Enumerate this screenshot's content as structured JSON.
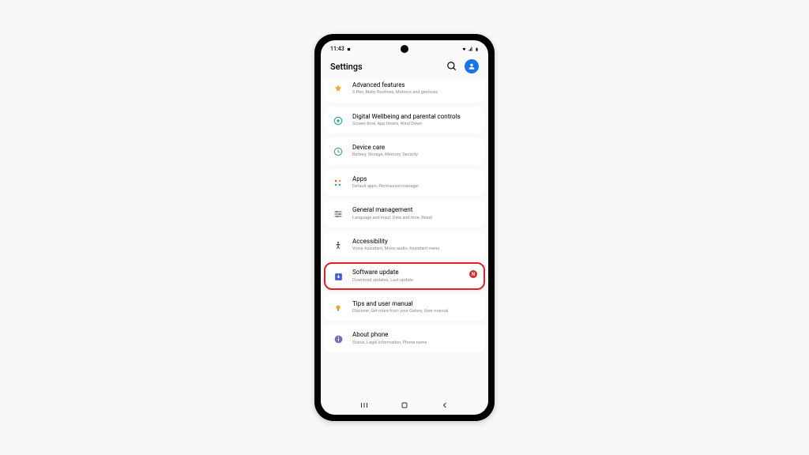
{
  "statusBar": {
    "time": "11:43"
  },
  "header": {
    "title": "Settings"
  },
  "items": [
    {
      "title": "Advanced features",
      "sub": "S Pen, Bixby Routines, Motions and gestures"
    },
    {
      "title": "Digital Wellbeing and parental controls",
      "sub": "Screen time, App timers, Wind Down"
    },
    {
      "title": "Device care",
      "sub": "Battery, Storage, Memory, Security"
    },
    {
      "title": "Apps",
      "sub": "Default apps, Permission manager"
    },
    {
      "title": "General management",
      "sub": "Language and input, Date and time, Reset"
    },
    {
      "title": "Accessibility",
      "sub": "Voice Assistant, Mono audio, Assistant menu"
    },
    {
      "title": "Software update",
      "sub": "Download updates, Last update"
    },
    {
      "title": "Tips and user manual",
      "sub": "Discover, Get more from your Galaxy, User manual"
    },
    {
      "title": "About phone",
      "sub": "Status, Legal information, Phone name"
    }
  ],
  "badge": "N"
}
